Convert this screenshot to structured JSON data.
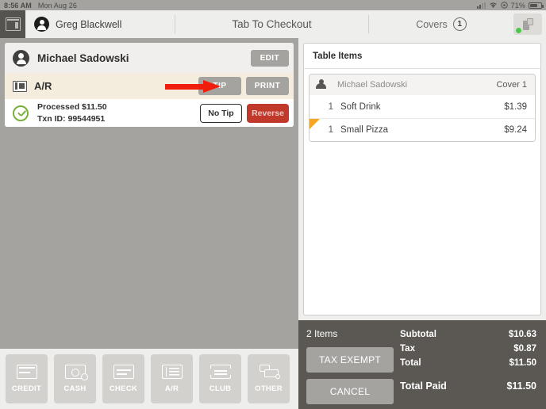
{
  "statusbar": {
    "time": "8:56 AM",
    "date": "Mon Aug 26",
    "battery_pct": "71%",
    "icons": [
      "signal-icon",
      "wifi-icon",
      "rotation-lock-icon",
      "battery-icon"
    ]
  },
  "navbar": {
    "app_icon": "register-icon",
    "user_name": "Greg Blackwell",
    "title": "Tab To Checkout",
    "covers_label": "Covers",
    "covers_count": "1",
    "printer_icon": "printer-icon",
    "printer_status": "online"
  },
  "payment": {
    "customer": {
      "name": "Michael Sadowski",
      "edit_label": "EDIT"
    },
    "tender": {
      "icon": "ar-ticket-icon",
      "label": "A/R",
      "tip_label": "TIP",
      "print_label": "PRINT"
    },
    "transaction": {
      "status_icon": "check-circle-icon",
      "status_line": "Processed $11.50",
      "txn_line": "Txn ID: 99544951",
      "no_tip_label": "No Tip",
      "reverse_label": "Reverse"
    },
    "annotation": {
      "type": "red-arrow",
      "points_to": "TIP",
      "color": "#f01c0c"
    }
  },
  "paybar": {
    "buttons": [
      {
        "label": "CREDIT",
        "icon": "credit-card-icon"
      },
      {
        "label": "CASH",
        "icon": "cash-icon"
      },
      {
        "label": "CHECK",
        "icon": "check-icon"
      },
      {
        "label": "A/R",
        "icon": "ar-ticket-icon"
      },
      {
        "label": "CLUB",
        "icon": "club-ticket-icon"
      },
      {
        "label": "OTHER",
        "icon": "other-payment-icon"
      }
    ]
  },
  "table_items": {
    "header": "Table Items",
    "cover": {
      "avatar_icon": "person-icon",
      "name": "Michael Sadowski",
      "cover_label": "Cover 1"
    },
    "items": [
      {
        "qty": "1",
        "name": "Soft Drink",
        "price": "$1.39",
        "flagged": false
      },
      {
        "qty": "1",
        "name": "Small Pizza",
        "price": "$9.24",
        "flagged": true
      }
    ]
  },
  "totals": {
    "item_count": "2 Items",
    "tax_exempt_label": "TAX EXEMPT",
    "cancel_label": "CANCEL",
    "subtotal_label": "Subtotal",
    "subtotal_value": "$10.63",
    "tax_label": "Tax",
    "tax_value": "$0.87",
    "total_label": "Total",
    "total_value": "$11.50",
    "total_paid_label": "Total Paid",
    "total_paid_value": "$11.50"
  }
}
